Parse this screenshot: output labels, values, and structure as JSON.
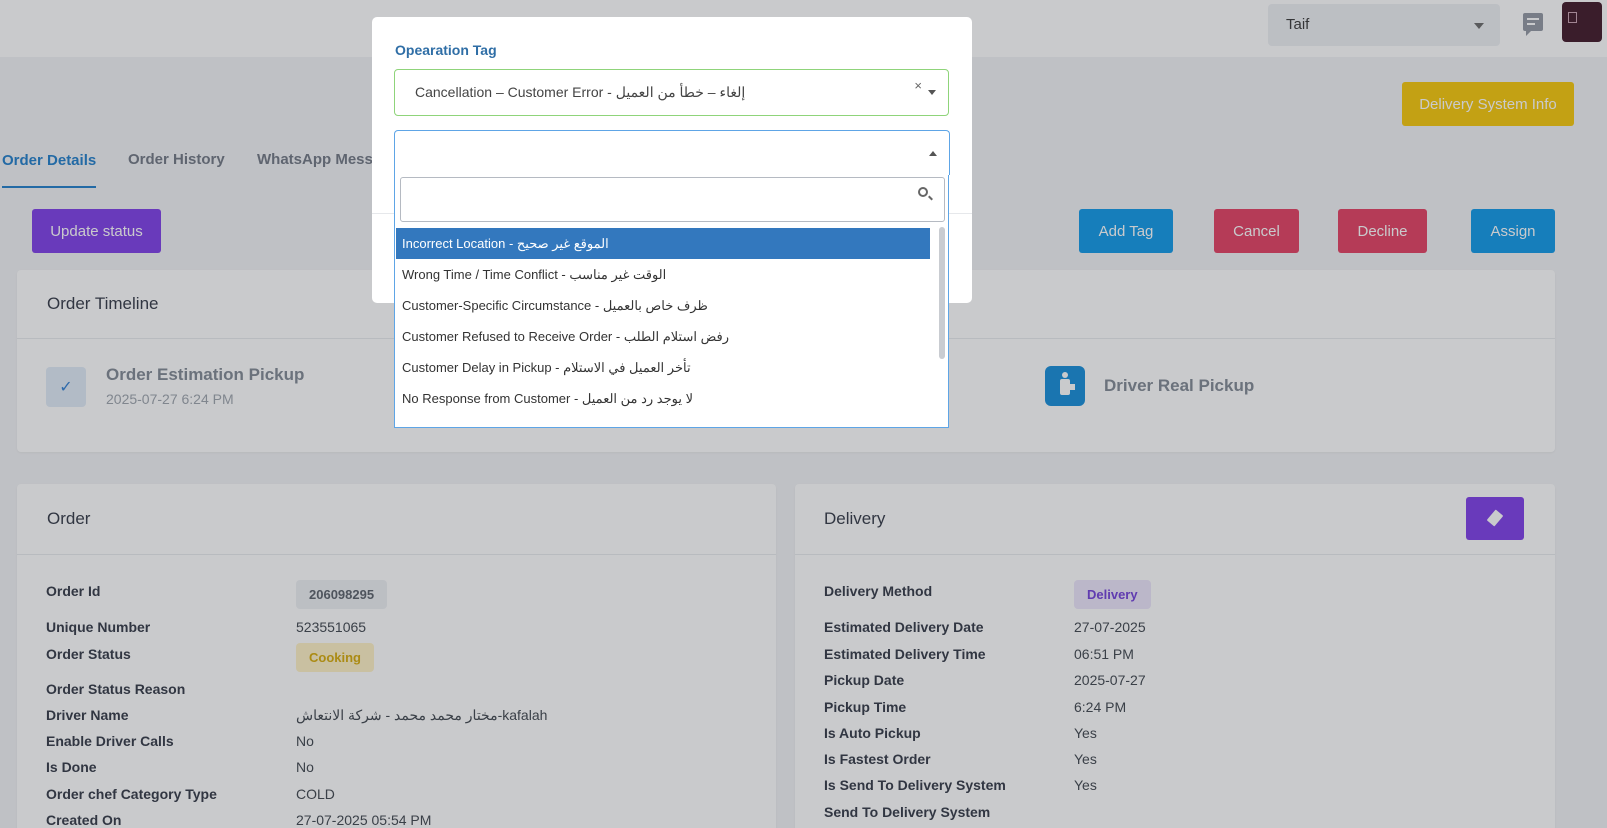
{
  "header": {
    "city": "Taif"
  },
  "top_actions": {
    "delivery_system_info": "Delivery System Info"
  },
  "tabs": [
    "Order Details",
    "Order History",
    "WhatsApp Mess"
  ],
  "actions": {
    "update_status": "Update status",
    "add_tag": "Add Tag",
    "cancel": "Cancel",
    "decline": "Decline",
    "assign": "Assign"
  },
  "timeline": {
    "title": "Order Timeline",
    "estimation_title": "Order Estimation Pickup",
    "estimation_date": "2025-07-27 6:24 PM",
    "driver_pickup_title": "Driver Real Pickup"
  },
  "order": {
    "title": "Order",
    "rows": [
      {
        "label": "Order Id",
        "value": "206098295"
      },
      {
        "label": "Unique Number",
        "value": "523551065"
      },
      {
        "label": "Order Status",
        "value": "Cooking"
      },
      {
        "label": "Order Status Reason",
        "value": ""
      },
      {
        "label": "Driver Name",
        "value": "مختار محمد محمد - شركة الانتعاش-kafalah"
      },
      {
        "label": "Enable Driver Calls",
        "value": "No"
      },
      {
        "label": "Is Done",
        "value": "No"
      },
      {
        "label": "Order chef Category Type",
        "value": "COLD"
      },
      {
        "label": "Created On",
        "value": "27-07-2025 05:54 PM"
      }
    ]
  },
  "delivery": {
    "title": "Delivery",
    "rows": [
      {
        "label": "Delivery Method",
        "value": "Delivery"
      },
      {
        "label": "Estimated Delivery Date",
        "value": "27-07-2025"
      },
      {
        "label": "Estimated Delivery Time",
        "value": "06:51 PM"
      },
      {
        "label": "Pickup Date",
        "value": "2025-07-27"
      },
      {
        "label": "Pickup Time",
        "value": "6:24 PM"
      },
      {
        "label": "Is Auto Pickup",
        "value": "Yes"
      },
      {
        "label": "Is Fastest Order",
        "value": "Yes"
      },
      {
        "label": "Is Send To Delivery System",
        "value": "Yes"
      },
      {
        "label": "Send To Delivery System",
        "value": ""
      }
    ]
  },
  "modal": {
    "tag_label": "Opearation Tag",
    "tag_value": "Cancellation – Customer Error - إلغاء – خطأ من العميل",
    "clear_symbol": "×",
    "search_value": "",
    "options": [
      "Incorrect Location - الموقع غير صحيح",
      "Wrong Time / Time Conflict - الوقت غير مناسب",
      "Customer-Specific Circumstance - ظرف خاص بالعميل",
      "Customer Refused to Receive Order - رفض استلام الطلب",
      "Customer Delay in Pickup - تأخر العميل في الاستلام",
      "No Response from Customer - لا يوجد رد من العميل"
    ],
    "selected_index": 0
  },
  "colors": {
    "accent_blue": "#1a7ac9",
    "purple": "#7a38e8",
    "red": "#e43a5e",
    "yellow": "#f7c600",
    "selected_option": "#3378be"
  }
}
